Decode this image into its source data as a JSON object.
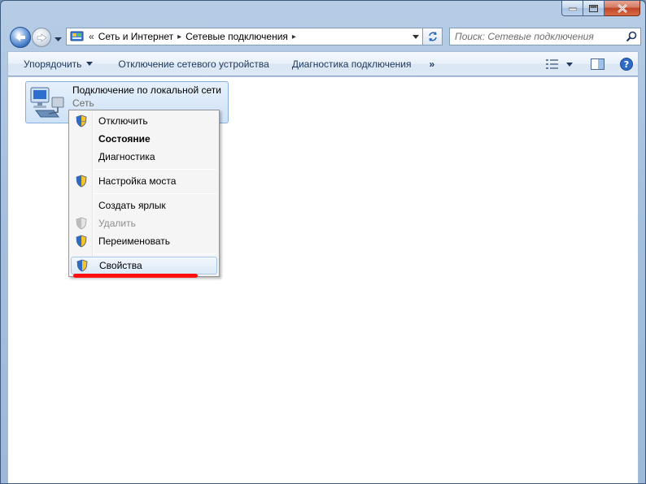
{
  "window": {
    "caption_buttons": {
      "minimize_icon": "minimize-icon",
      "maximize_icon": "maximize-icon",
      "close_icon": "close-icon"
    }
  },
  "address_bar": {
    "overflow": "«",
    "breadcrumbs": [
      "Сеть и Интернет",
      "Сетевые подключения"
    ],
    "separator": "▸"
  },
  "search": {
    "placeholder": "Поиск: Сетевые подключения"
  },
  "toolbar": {
    "organize_label": "Упорядочить",
    "disconnect_label": "Отключение сетевого устройства",
    "diagnose_label": "Диагностика подключения",
    "more_label": "»"
  },
  "connection": {
    "name": "Подключение по локальной сети",
    "status": "Сеть"
  },
  "context_menu": {
    "items": [
      {
        "label": "Отключить"
      },
      {
        "label": "Состояние"
      },
      {
        "label": "Диагностика"
      },
      {
        "label": "Настройка моста"
      },
      {
        "label": "Создать ярлык"
      },
      {
        "label": "Удалить"
      },
      {
        "label": "Переименовать"
      },
      {
        "label": "Свойства"
      }
    ]
  },
  "colors": {
    "highlight_underline": "#ff1010",
    "window_frame": "#a6c0de",
    "command_bar_text": "#1e395b"
  }
}
